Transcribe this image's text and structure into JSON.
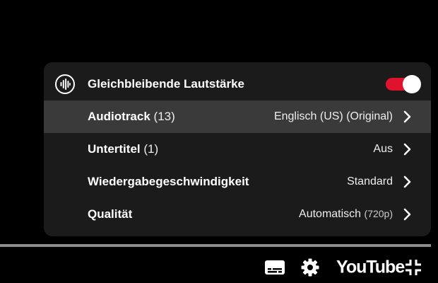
{
  "settings_menu": {
    "rows": [
      {
        "icon": "stable-volume-icon",
        "label": "Gleichbleibende Lautstärke",
        "toggle_on": true,
        "toggle_color": "#e0132f"
      },
      {
        "label": "Audiotrack",
        "count": "(13)",
        "value": "Englisch (US) (Original)",
        "highlighted": true
      },
      {
        "label": "Untertitel",
        "count": "(1)",
        "value": "Aus"
      },
      {
        "label": "Wiedergabegeschwindigkeit",
        "value": "Standard"
      },
      {
        "label": "Qualität",
        "value": "Automatisch",
        "value_sub": "(720p)"
      }
    ]
  },
  "player_controls": {
    "subtitles_icon": "subtitles-icon",
    "settings_icon": "gear-icon",
    "logo_text": "YouTube",
    "exit_fullscreen_icon": "exit-fullscreen-icon"
  }
}
